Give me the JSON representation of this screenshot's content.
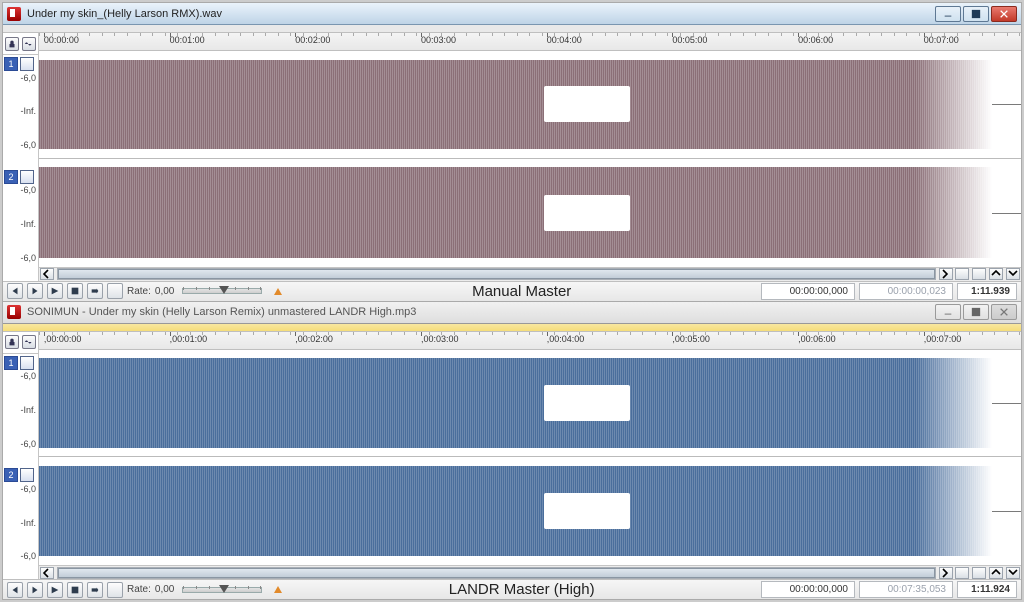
{
  "panels": [
    {
      "title": "Under my skin_(Helly Larson RMX).wav",
      "active": true,
      "ruler": [
        "00:00:00",
        "00:01:00",
        "00:02:00",
        "00:03:00",
        "00:04:00",
        "00:05:00",
        "00:06:00",
        "00:07:00"
      ],
      "amp_ticks": [
        "-6,0",
        "-Inf.",
        "-6,0"
      ],
      "channels": [
        "1",
        "2"
      ],
      "color": "purple",
      "rate_label": "Rate:",
      "rate_value": "0,00",
      "timecode_start": "00:00:00,000",
      "timecode_end": "00:00:00,023",
      "duration": "1:11.939",
      "caption": "Manual Master"
    },
    {
      "title": "SONIMUN - Under my skin (Helly Larson Remix) unmastered LANDR High.mp3",
      "active": false,
      "ruler": [
        ",00:00:00",
        ",00:01:00",
        ",00:02:00",
        ",00:03:00",
        ",00:04:00",
        ",00:05:00",
        ",00:06:00",
        ",00:07:00"
      ],
      "amp_ticks": [
        "-6,0",
        "-Inf.",
        "-6,0"
      ],
      "channels": [
        "1",
        "2"
      ],
      "color": "blue",
      "rate_label": "Rate:",
      "rate_value": "0,00",
      "timecode_start": "00:00:00,000",
      "timecode_end": "00:07:35,053",
      "duration": "1:11.924",
      "caption": "LANDR Master (High)"
    }
  ]
}
